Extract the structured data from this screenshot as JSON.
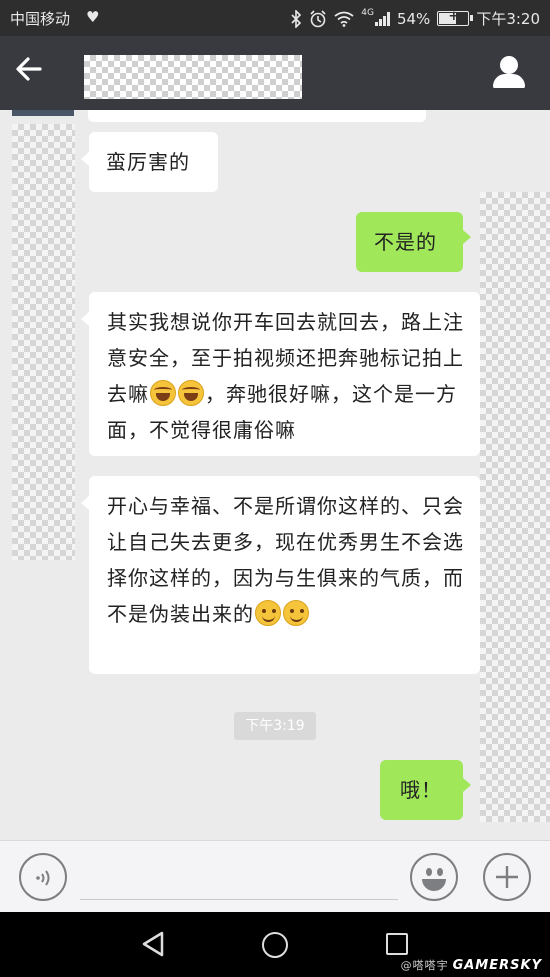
{
  "status_bar": {
    "carrier": "中国移动",
    "network": "4G",
    "battery": "54%",
    "time": "下午3:20"
  },
  "header": {
    "back_icon": "arrow-left-icon",
    "profile_icon": "person-icon"
  },
  "messages": [
    {
      "side": "left",
      "text": "蛮厉害的"
    },
    {
      "side": "right",
      "text": "不是的"
    },
    {
      "side": "left",
      "text": "其实我想说你开车回去就回去，路上注意安全，至于拍视频还把奔驰标记拍上去嘛",
      "emojis": [
        "laugh",
        "laugh"
      ],
      "text_after": "，奔驰很好嘛，这个是一方面，不觉得很庸俗嘛"
    },
    {
      "side": "left",
      "text": "开心与幸福、不是所谓你这样的、只会让自己失去更多，现在优秀男生不会选择你这样的，因为与生俱来的气质，而不是伪装出来的",
      "emojis": [
        "smile",
        "smile"
      ]
    },
    {
      "side": "right",
      "text": "哦！"
    }
  ],
  "timestamp": "下午3:19",
  "watermark": {
    "brand": "GAMERSKY",
    "handle": "@嗒嗒宇"
  },
  "colors": {
    "status_bg": "#2e2e2e",
    "header_bg": "#393a3f",
    "chat_bg": "#ebebeb",
    "bubble_right": "#a0e75a",
    "bubble_left": "#ffffff"
  }
}
